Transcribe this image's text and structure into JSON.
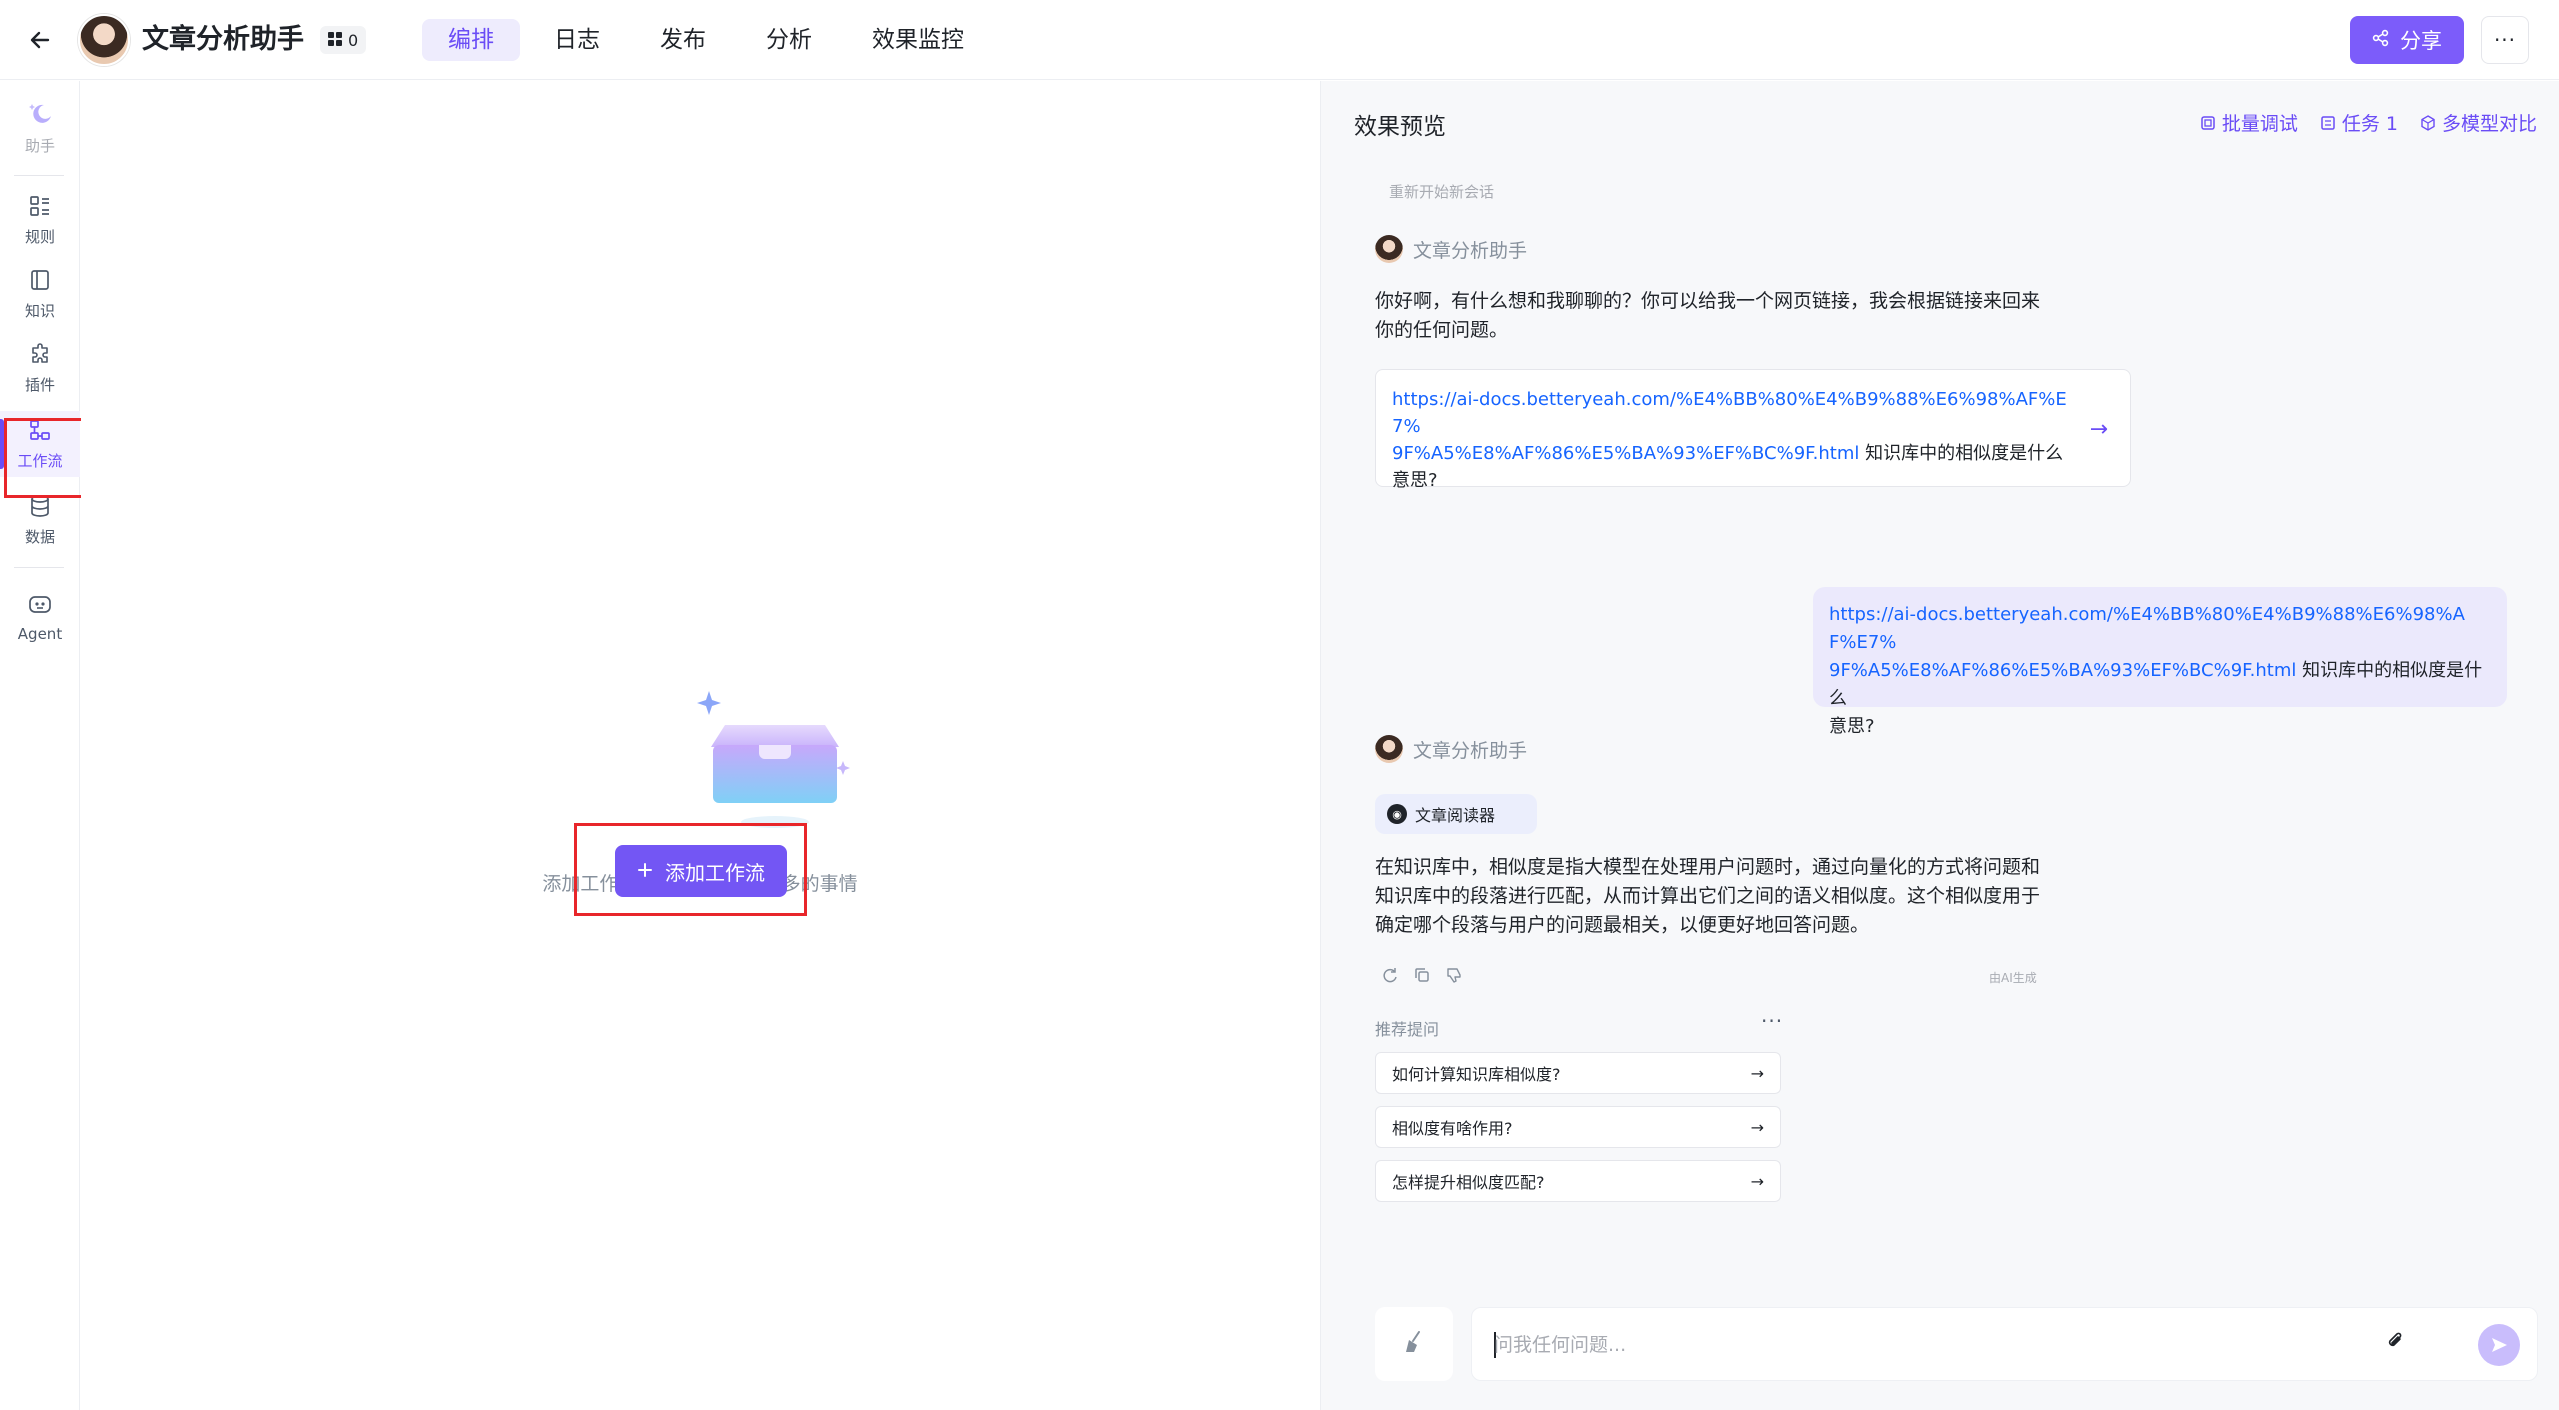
{
  "header": {
    "app_title": "文章分析助手",
    "badge_count": "0",
    "tabs": [
      {
        "label": "编排",
        "active": true
      },
      {
        "label": "日志",
        "active": false
      },
      {
        "label": "发布",
        "active": false
      },
      {
        "label": "分析",
        "active": false
      },
      {
        "label": "效果监控",
        "active": false
      }
    ],
    "share_label": "分享",
    "more_label": "···"
  },
  "sidebar": {
    "items": [
      {
        "label": "助手",
        "icon": "moon-icon"
      },
      {
        "label": "规则",
        "icon": "grid-list-icon"
      },
      {
        "label": "知识",
        "icon": "book-icon"
      },
      {
        "label": "插件",
        "icon": "puzzle-icon"
      },
      {
        "label": "工作流",
        "icon": "workflow-icon"
      },
      {
        "label": "数据",
        "icon": "database-icon"
      },
      {
        "label": "Agent",
        "icon": "agent-icon"
      }
    ],
    "active": "工作流"
  },
  "workflow_empty": {
    "text": "添加工作流，让 Agent 做更多的事情",
    "add_button": "添加工作流"
  },
  "preview": {
    "title": "效果预览",
    "actions": [
      {
        "label": "批量调试",
        "icon": "batch-icon"
      },
      {
        "label": "任务 1",
        "icon": "task-icon"
      },
      {
        "label": "多模型对比",
        "icon": "cube-icon"
      }
    ],
    "restart_label": "重新开始新会话",
    "bot_name": "文章分析助手",
    "greeting": "你好啊，有什么想和我聊聊的？你可以给我一个网页链接，我会根据链接来回来你的任何问题。",
    "greeting_line1": "你好啊，有什么想和我聊聊的？你可以给我一个网页链接，我会根据链接来回来",
    "greeting_line2": "你的任何问题。",
    "link_url": "https://ai-docs.betteryeah.com/%E4%BB%80%E4%B9%88%E6%98%AF%E7%9F%A5%E8%AF%86%E5%BA%93%EF%BC%9F.html",
    "link_url_line1": "https://ai-docs.betteryeah.com/%E4%BB%80%E4%B9%88%E6%98%AF%E7%",
    "link_url_line2": "9F%A5%E8%AF%86%E5%BA%93%EF%BC%9F.html",
    "link_question_part1": " 知识库中的相似度是什么",
    "link_question_part2": "意思?",
    "user_url_line1": "https://ai-docs.betteryeah.com/%E4%BB%80%E4%B9%88%E6%98%AF%E7%",
    "user_url_line2": "9F%A5%E8%AF%86%E5%BA%93%EF%BC%9F.html",
    "user_question_part1": " 知识库中的相似度是什么",
    "user_question_part2": "意思?",
    "tool_name": "文章阅读器",
    "answer_line1": "在知识库中，相似度是指大模型在处理用户问题时，通过向量化的方式将问题和",
    "answer_line2": "知识库中的段落进行匹配，从而计算出它们之间的语义相似度。这个相似度用于",
    "answer_line3": "确定哪个段落与用户的问题最相关，以便更好地回答问题。",
    "ai_note": "由AI生成",
    "recommend_title": "推荐提问",
    "recommendations": [
      "如何计算知识库相似度?",
      "相似度有啥作用?",
      "怎样提升相似度匹配?"
    ],
    "input_placeholder": "问我任何问题..."
  },
  "colors": {
    "accent": "#7356f4",
    "accent_light": "#eeecfd",
    "link": "#1664ff",
    "highlight_box": "#e8262a"
  }
}
